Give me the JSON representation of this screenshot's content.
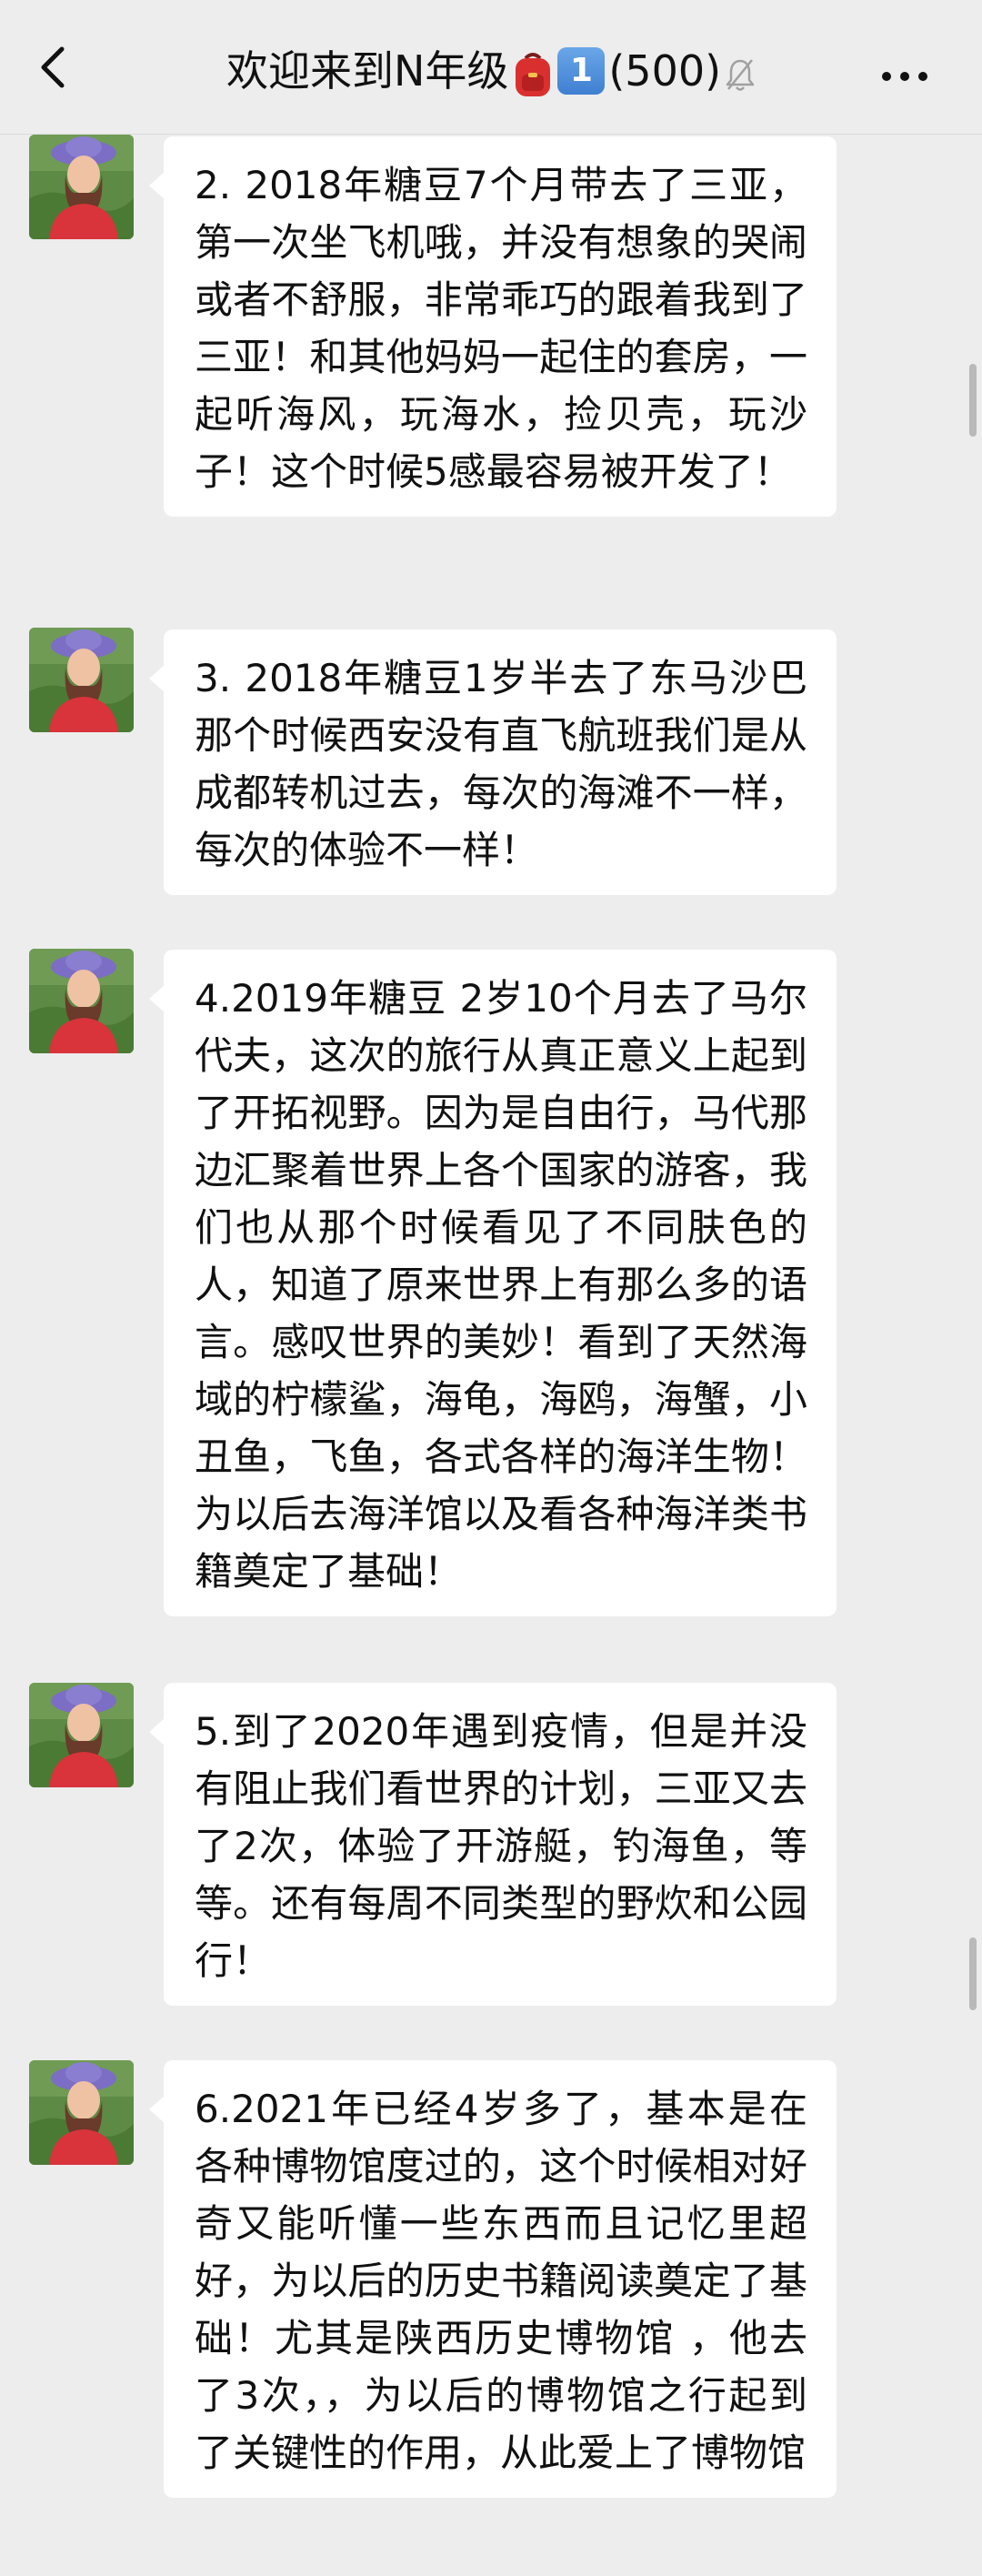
{
  "header": {
    "title_text": "欢迎来到N年级",
    "title_count": "(500)",
    "keycap_label": "1",
    "icons": {
      "back": "chevron-left-icon",
      "backpack": "backpack-icon",
      "keycap": "keycap-1-icon",
      "mute": "bell-muted-icon",
      "more": "more-dots-icon"
    }
  },
  "messages": [
    {
      "text": "2. 2018年糖豆7个月带去了三亚，第一次坐飞机哦，并没有想象的哭闹或者不舒服，非常乖巧的跟着我到了三亚！和其他妈妈一起住的套房，一起听海风，玩海水，捡贝壳，玩沙子！这个时候5感最容易被开发了！"
    },
    {
      "text": "3. 2018年糖豆1岁半去了东马沙巴那个时候西安没有直飞航班我们是从成都转机过去，每次的海滩不一样，每次的体验不一样！"
    },
    {
      "text": "4.2019年糖豆 2岁10个月去了马尔代夫，这次的旅行从真正意义上起到了开拓视野。因为是自由行，马代那边汇聚着世界上各个国家的游客，我们也从那个时候看见了不同肤色的人，知道了原来世界上有那么多的语言。感叹世界的美妙！看到了天然海域的柠檬鲨，海龟，海鸥，海蟹，小丑鱼，飞鱼，各式各样的海洋生物！为以后去海洋馆以及看各种海洋类书籍奠定了基础！"
    },
    {
      "text": "5.到了2020年遇到疫情，但是并没有阻止我们看世界的计划，三亚又去了2次，体验了开游艇，钓海鱼，等等。还有每周不同类型的野炊和公园行！"
    },
    {
      "text": "6.2021年已经4岁多了，基本是在各种博物馆度过的，这个时候相对好奇又能听懂一些东西而且记忆里超好，为以后的历史书籍阅读奠定了基础！尤其是陕西历史博物馆 ，他去了3次，，为以后的博物馆之行起到了关键性的作用，从此爱上了博物馆"
    }
  ],
  "colors": {
    "background": "#ededed",
    "bubble": "#ffffff",
    "text": "#111111"
  }
}
